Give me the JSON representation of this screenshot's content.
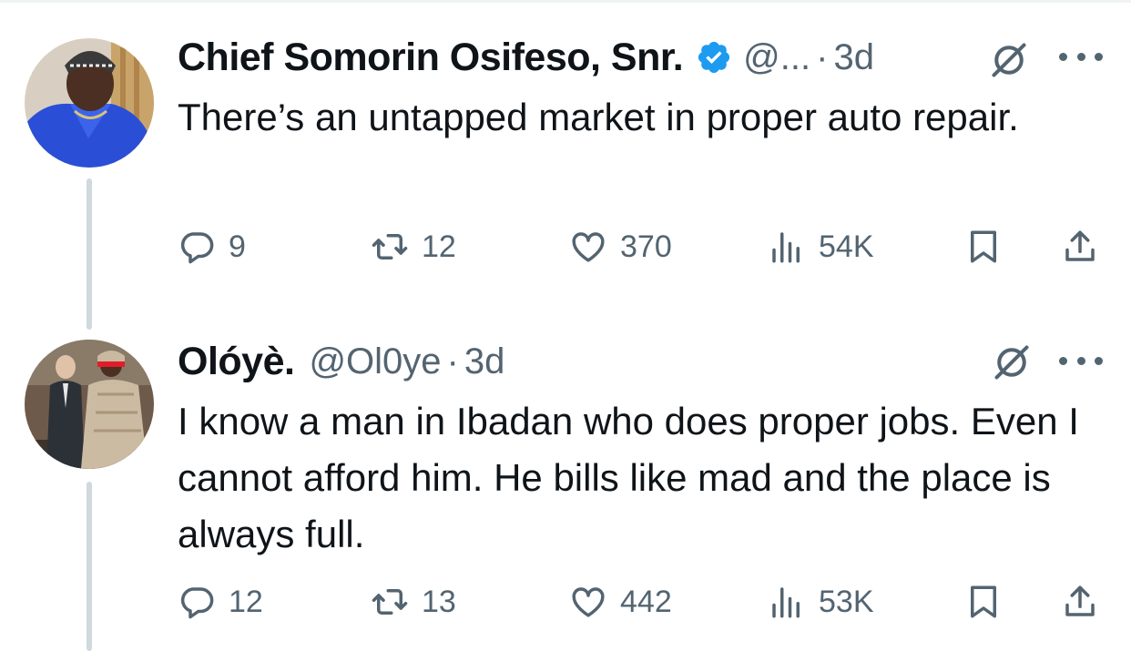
{
  "tweets": [
    {
      "name": "Chief Somorin Osifeso, Snr.",
      "verified": true,
      "handle": "@...",
      "dot": "·",
      "time": "3d",
      "text": "There’s an untapped market in proper auto repair.",
      "stats": {
        "replies": "9",
        "retweets": "12",
        "likes": "370",
        "views": "54K"
      }
    },
    {
      "name": "Olóyè.",
      "verified": false,
      "handle": "@Ol0ye",
      "dot": "·",
      "time": "3d",
      "text": "I know a man in Ibadan who does proper jobs. Even I cannot afford him. He bills like mad and the place is always full.",
      "stats": {
        "replies": "12",
        "retweets": "13",
        "likes": "442",
        "views": "53K"
      }
    }
  ],
  "colors": {
    "text": "#0f1419",
    "secondary": "#536471",
    "verified": "#1d9bf0",
    "thread": "#cfd9de"
  },
  "icons": [
    "reply-icon",
    "retweet-icon",
    "like-icon",
    "views-icon",
    "bookmark-icon",
    "share-icon",
    "grok-icon",
    "more-icon",
    "verified-badge-icon"
  ]
}
